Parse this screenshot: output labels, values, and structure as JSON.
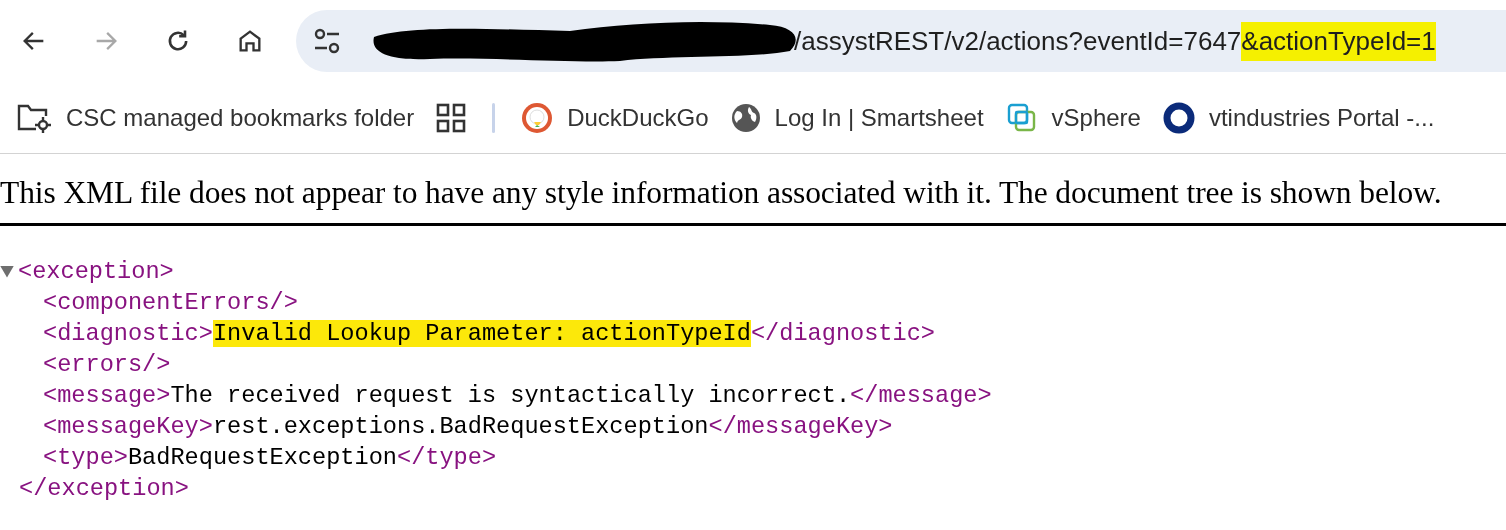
{
  "toolbar": {
    "buttons": [
      {
        "kind": "back",
        "disabled": false
      },
      {
        "kind": "forward",
        "disabled": true
      },
      {
        "kind": "reload",
        "disabled": false
      },
      {
        "kind": "home",
        "disabled": false
      }
    ]
  },
  "address_bar": {
    "redacted": true,
    "url_parts": [
      {
        "text": "/assystREST/v2/actions?eventId=7647",
        "highlighted": false
      },
      {
        "text": "&actionTypeId=1",
        "highlighted": true
      }
    ]
  },
  "bookmarks": [
    {
      "kind": "managed-folder",
      "label": "CSC managed bookmarks folder"
    },
    {
      "kind": "apps"
    },
    {
      "kind": "separator"
    },
    {
      "kind": "duck",
      "label": "DuckDuckGo"
    },
    {
      "kind": "globe",
      "label": "Log In | Smartsheet"
    },
    {
      "kind": "vsphere",
      "label": "vSphere"
    },
    {
      "kind": "ring",
      "label": "vtindustries Portal -..."
    }
  ],
  "info_message": "This XML file does not appear to have any style information associated with it. The document tree is shown below.",
  "xml_tree": {
    "open": "<exception>",
    "close": "</exception>",
    "expanded": true,
    "children": [
      {
        "open": "<componentErrors/>"
      },
      {
        "open": "<diagnostic>",
        "text": "Invalid Lookup Parameter: actionTypeId",
        "close": "</diagnostic>",
        "highlighted": true
      },
      {
        "open": "<errors/>"
      },
      {
        "open": "<message>",
        "text": "The received request is syntactically incorrect.",
        "close": "</message>",
        "highlighted": false
      },
      {
        "open": "<messageKey>",
        "text": "rest.exceptions.BadRequestException",
        "close": "</messageKey>",
        "highlighted": false
      },
      {
        "open": "<type>",
        "text": "BadRequestException",
        "close": "</type>",
        "highlighted": false
      }
    ]
  }
}
